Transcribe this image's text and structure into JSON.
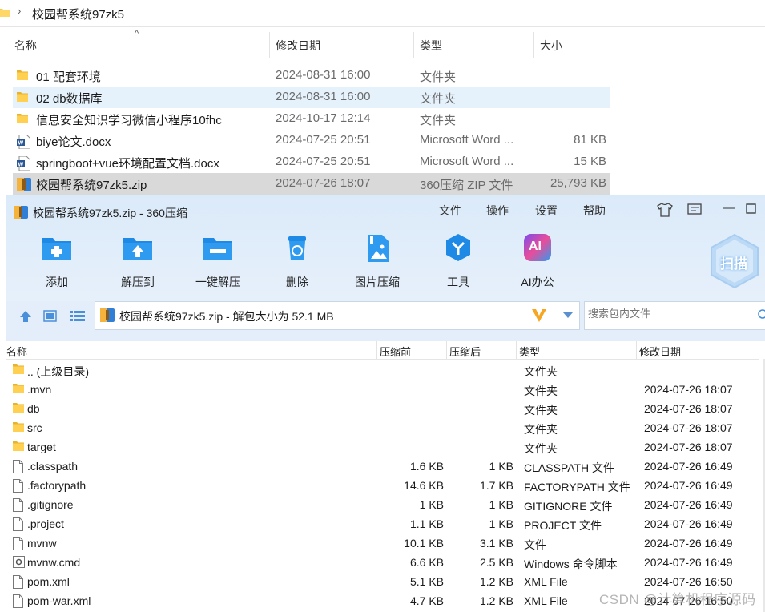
{
  "explorer": {
    "breadcrumb": "校园帮系统97zk5",
    "columns": {
      "name": "名称",
      "date": "修改日期",
      "type": "类型",
      "size": "大小"
    },
    "rows": [
      {
        "name": "01 配套环境",
        "date": "2024-08-31 16:00",
        "type": "文件夹",
        "size": "",
        "icon": "folder-icon"
      },
      {
        "name": "02 db数据库",
        "date": "2024-08-31 16:00",
        "type": "文件夹",
        "size": "",
        "icon": "folder-icon"
      },
      {
        "name": "信息安全知识学习微信小程序10fhc",
        "date": "2024-10-17 12:14",
        "type": "文件夹",
        "size": "",
        "icon": "folder-icon"
      },
      {
        "name": "biye论文.docx",
        "date": "2024-07-25 20:51",
        "type": "Microsoft Word ...",
        "size": "81 KB",
        "icon": "word-doc-icon"
      },
      {
        "name": "springboot+vue环境配置文档.docx",
        "date": "2024-07-25 20:51",
        "type": "Microsoft Word ...",
        "size": "15 KB",
        "icon": "word-doc-icon"
      },
      {
        "name": "校园帮系统97zk5.zip",
        "date": "2024-07-26 18:07",
        "type": "360压缩 ZIP 文件",
        "size": "25,793 KB",
        "icon": "zip-archive-icon"
      }
    ]
  },
  "zip_window": {
    "title": "校园帮系统97zk5.zip - 360压缩",
    "menu": [
      "文件",
      "操作",
      "设置",
      "帮助"
    ],
    "toolbar": [
      {
        "label": "添加",
        "icon": "add-icon"
      },
      {
        "label": "解压到",
        "icon": "extract-to-icon"
      },
      {
        "label": "一键解压",
        "icon": "one-click-extract-icon"
      },
      {
        "label": "删除",
        "icon": "delete-icon"
      },
      {
        "label": "图片压缩",
        "icon": "image-compress-icon"
      },
      {
        "label": "工具",
        "icon": "tools-icon"
      },
      {
        "label": "AI办公",
        "icon": "ai-office-icon"
      }
    ],
    "scan_label": "扫描",
    "address": "校园帮系统97zk5.zip - 解包大小为 52.1 MB",
    "search_placeholder": "搜索包内文件",
    "columns": {
      "name": "名称",
      "before": "压缩前",
      "after": "压缩后",
      "type": "类型",
      "date": "修改日期"
    },
    "rows": [
      {
        "name": ".. (上级目录)",
        "before": "",
        "after": "",
        "type": "文件夹",
        "date": "",
        "icon": "folder-icon"
      },
      {
        "name": ".mvn",
        "before": "",
        "after": "",
        "type": "文件夹",
        "date": "2024-07-26 18:07",
        "icon": "folder-icon"
      },
      {
        "name": "db",
        "before": "",
        "after": "",
        "type": "文件夹",
        "date": "2024-07-26 18:07",
        "icon": "folder-icon"
      },
      {
        "name": "src",
        "before": "",
        "after": "",
        "type": "文件夹",
        "date": "2024-07-26 18:07",
        "icon": "folder-icon"
      },
      {
        "name": "target",
        "before": "",
        "after": "",
        "type": "文件夹",
        "date": "2024-07-26 18:07",
        "icon": "folder-icon"
      },
      {
        "name": ".classpath",
        "before": "1.6 KB",
        "after": "1 KB",
        "type": "CLASSPATH 文件",
        "date": "2024-07-26 16:49",
        "icon": "file-icon"
      },
      {
        "name": ".factorypath",
        "before": "14.6 KB",
        "after": "1.7 KB",
        "type": "FACTORYPATH 文件",
        "date": "2024-07-26 16:49",
        "icon": "file-icon"
      },
      {
        "name": ".gitignore",
        "before": "1 KB",
        "after": "1 KB",
        "type": "GITIGNORE 文件",
        "date": "2024-07-26 16:49",
        "icon": "file-icon"
      },
      {
        "name": ".project",
        "before": "1.1 KB",
        "after": "1 KB",
        "type": "PROJECT 文件",
        "date": "2024-07-26 16:49",
        "icon": "file-icon"
      },
      {
        "name": "mvnw",
        "before": "10.1 KB",
        "after": "3.1 KB",
        "type": "文件",
        "date": "2024-07-26 16:49",
        "icon": "file-icon"
      },
      {
        "name": "mvnw.cmd",
        "before": "6.6 KB",
        "after": "2.5 KB",
        "type": "Windows 命令脚本",
        "date": "2024-07-26 16:49",
        "icon": "cmd-script-icon"
      },
      {
        "name": "pom.xml",
        "before": "5.1 KB",
        "after": "1.2 KB",
        "type": "XML File",
        "date": "2024-07-26 16:50",
        "icon": "file-icon"
      },
      {
        "name": "pom-war.xml",
        "before": "4.7 KB",
        "after": "1.2 KB",
        "type": "XML File",
        "date": "2024-07-26 16:50",
        "icon": "file-icon"
      }
    ]
  },
  "watermark": "CSDN @计算机程序源码"
}
